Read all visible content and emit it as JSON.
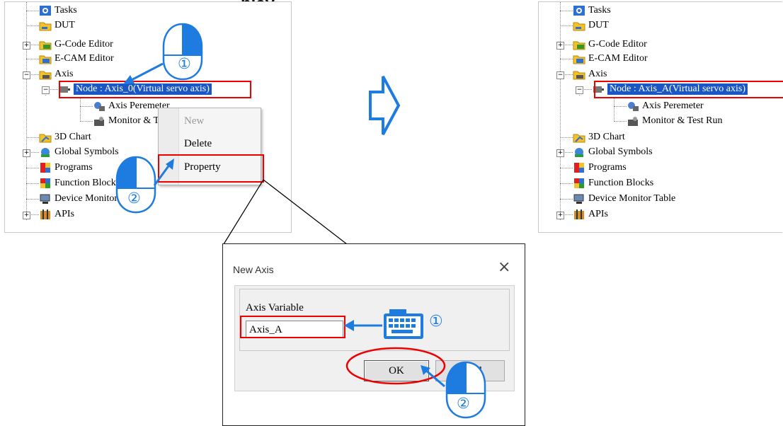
{
  "heading_partial": "play",
  "left_tree": {
    "items": [
      {
        "label": "Tasks"
      },
      {
        "label": "DUT"
      },
      {
        "label": "G-Code Editor"
      },
      {
        "label": "E-CAM Editor"
      },
      {
        "label": "Axis"
      },
      {
        "label": "Node : Axis_0(Virtual servo axis)"
      },
      {
        "label": "Axis Peremeter"
      },
      {
        "label": "Monitor & Test Run"
      },
      {
        "label": "3D Chart"
      },
      {
        "label": "Global Symbols"
      },
      {
        "label": "Programs"
      },
      {
        "label": "Function Blocks"
      },
      {
        "label": "Device Monitor Table"
      },
      {
        "label": "APIs"
      }
    ]
  },
  "context_menu": {
    "new": "New",
    "delete": "Delete",
    "property": "Property"
  },
  "right_tree": {
    "items": [
      {
        "label": "Tasks"
      },
      {
        "label": "DUT"
      },
      {
        "label": "G-Code Editor"
      },
      {
        "label": "E-CAM Editor"
      },
      {
        "label": "Axis"
      },
      {
        "label": "Node : Axis_A(Virtual servo axis)"
      },
      {
        "label": "Axis Peremeter"
      },
      {
        "label": "Monitor & Test Run"
      },
      {
        "label": "3D Chart"
      },
      {
        "label": "Global Symbols"
      },
      {
        "label": "Programs"
      },
      {
        "label": "Function Blocks"
      },
      {
        "label": "Device Monitor Table"
      },
      {
        "label": "APIs"
      }
    ]
  },
  "dialog": {
    "title": "New Axis",
    "close_glyph": "×",
    "group_label": "Axis Variable",
    "input_value": "Axis_A",
    "ok_label": "OK",
    "cancel_label_partial": "ncel"
  },
  "step_markers": {
    "one": "①",
    "two": "②"
  },
  "colors": {
    "accent_blue": "#1e7be0",
    "highlight_red": "#e00000",
    "selection_blue": "#1a56c4"
  }
}
